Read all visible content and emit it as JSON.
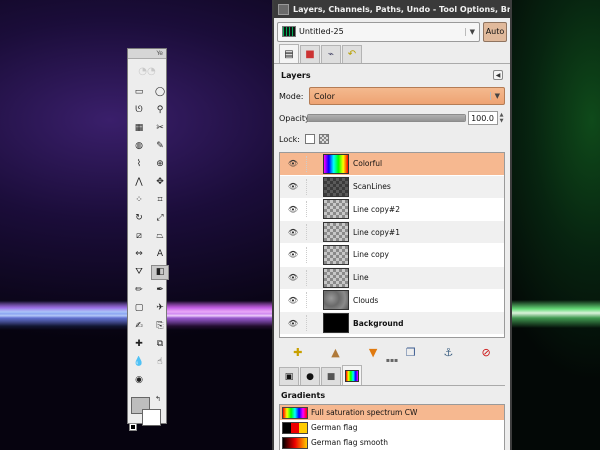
{
  "dock": {
    "title": "Layers, Channels, Paths, Undo - Tool Options, Brushes, P",
    "image_name": "Untitled-25",
    "auto_label": "Auto",
    "dock_tabs": [
      "layers-tab-icon",
      "channels-tab-icon",
      "paths-tab-icon",
      "undo-tab-icon"
    ]
  },
  "layers_panel": {
    "title": "Layers",
    "mode_label": "Mode:",
    "mode_value": "Color",
    "opacity_label": "Opacity:",
    "opacity_value": "100.0",
    "opacity_fraction": 1.0,
    "lock_label": "Lock:",
    "layers": [
      {
        "name": "Colorful",
        "selected": true,
        "bold": false,
        "thumb": "rainbow"
      },
      {
        "name": "ScanLines",
        "selected": false,
        "bold": false,
        "thumb": "checker-dark"
      },
      {
        "name": "Line copy#2",
        "selected": false,
        "bold": false,
        "thumb": "checker"
      },
      {
        "name": "Line copy#1",
        "selected": false,
        "bold": false,
        "thumb": "checker"
      },
      {
        "name": "Line copy",
        "selected": false,
        "bold": false,
        "thumb": "checker"
      },
      {
        "name": "Line",
        "selected": false,
        "bold": false,
        "thumb": "checker"
      },
      {
        "name": "Clouds",
        "selected": false,
        "bold": false,
        "thumb": "clouds"
      },
      {
        "name": "Background",
        "selected": false,
        "bold": true,
        "thumb": "black"
      }
    ],
    "actions": [
      {
        "name": "new-layer-button",
        "icon": "new-layer-icon",
        "glyph": "✚",
        "color": "#c8a000"
      },
      {
        "name": "raise-layer-button",
        "icon": "raise-arrow-icon",
        "glyph": "▲",
        "color": "#b07a3a"
      },
      {
        "name": "lower-layer-button",
        "icon": "lower-arrow-icon",
        "glyph": "▼",
        "color": "#e07a10"
      },
      {
        "name": "duplicate-layer-button",
        "icon": "duplicate-icon",
        "glyph": "❐",
        "color": "#3a5a90"
      },
      {
        "name": "anchor-layer-button",
        "icon": "anchor-icon",
        "glyph": "⚓",
        "color": "#4a6a8a"
      },
      {
        "name": "delete-layer-button",
        "icon": "delete-icon",
        "glyph": "⊘",
        "color": "#cc1111"
      }
    ]
  },
  "gradients_panel": {
    "title": "Gradients",
    "tabs": [
      "brushes-tab-icon",
      "patterns-tab-icon",
      "fonts-tab-icon",
      "gradients-tab-icon"
    ],
    "gradients": [
      {
        "name": "Full saturation spectrum CW",
        "selected": true,
        "thumb": "spectrum"
      },
      {
        "name": "German flag",
        "selected": false,
        "thumb": "german"
      },
      {
        "name": "German flag smooth",
        "selected": false,
        "thumb": "german-smooth"
      }
    ]
  },
  "toolbox": {
    "title_mark": "Ye",
    "logo_glyph": "◔◔",
    "tools": [
      {
        "name": "rect-select-icon",
        "glyph": "▭"
      },
      {
        "name": "ellipse-select-icon",
        "glyph": "◯"
      },
      {
        "name": "free-select-icon",
        "glyph": "ᘎ"
      },
      {
        "name": "fuzzy-select-icon",
        "glyph": "⚲"
      },
      {
        "name": "select-by-color-icon",
        "glyph": "▦"
      },
      {
        "name": "scissors-icon",
        "glyph": "✂"
      },
      {
        "name": "foreground-select-icon",
        "glyph": "◍"
      },
      {
        "name": "paths-icon",
        "glyph": "✎"
      },
      {
        "name": "color-picker-icon",
        "glyph": "⌇"
      },
      {
        "name": "zoom-icon",
        "glyph": "⊕"
      },
      {
        "name": "measure-icon",
        "glyph": "⋀"
      },
      {
        "name": "move-icon",
        "glyph": "✥"
      },
      {
        "name": "align-icon",
        "glyph": "⁘"
      },
      {
        "name": "crop-icon",
        "glyph": "⌗"
      },
      {
        "name": "rotate-icon",
        "glyph": "↻"
      },
      {
        "name": "scale-icon",
        "glyph": "⤢"
      },
      {
        "name": "shear-icon",
        "glyph": "⧄"
      },
      {
        "name": "perspective-icon",
        "glyph": "⏢"
      },
      {
        "name": "flip-icon",
        "glyph": "⇔"
      },
      {
        "name": "text-icon",
        "glyph": "A"
      },
      {
        "name": "bucket-fill-icon",
        "glyph": "⛛"
      },
      {
        "name": "blend-icon",
        "glyph": "◧"
      },
      {
        "name": "pencil-icon",
        "glyph": "✏"
      },
      {
        "name": "paintbrush-icon",
        "glyph": "✒"
      },
      {
        "name": "eraser-icon",
        "glyph": "▢"
      },
      {
        "name": "airbrush-icon",
        "glyph": "✈"
      },
      {
        "name": "ink-icon",
        "glyph": "✍"
      },
      {
        "name": "clone-icon",
        "glyph": "⎘"
      },
      {
        "name": "heal-icon",
        "glyph": "✚"
      },
      {
        "name": "perspective-clone-icon",
        "glyph": "⧉"
      },
      {
        "name": "blur-icon",
        "glyph": "💧"
      },
      {
        "name": "smudge-icon",
        "glyph": "☝"
      },
      {
        "name": "dodge-burn-icon",
        "glyph": "◉"
      }
    ],
    "selected_tool": 21,
    "fg_color": "#bdbdbd",
    "bg_color": "#ffffff"
  }
}
